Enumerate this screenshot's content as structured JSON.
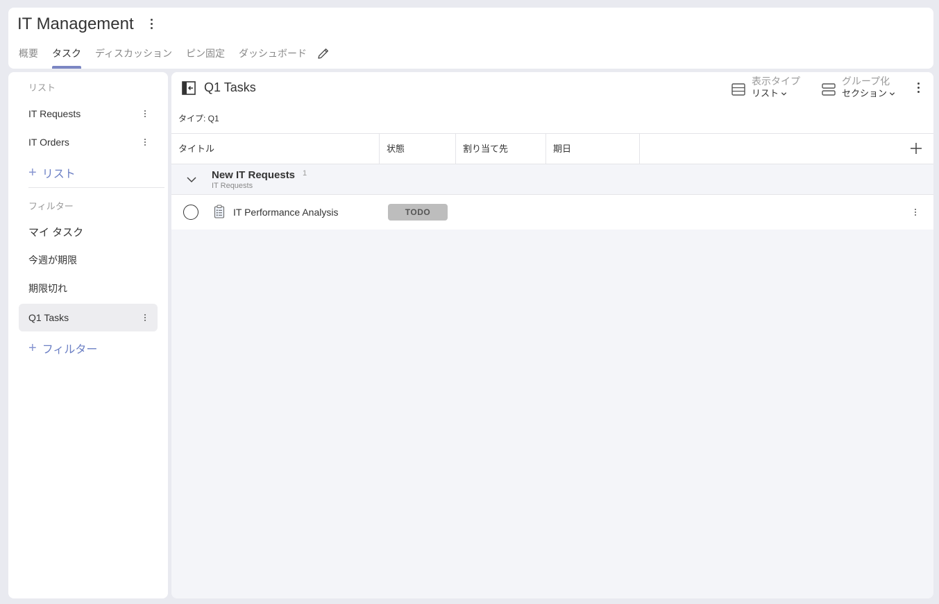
{
  "header": {
    "title": "IT Management",
    "tabs": [
      {
        "label": "概要"
      },
      {
        "label": "タスク"
      },
      {
        "label": "ディスカッション"
      },
      {
        "label": "ピン固定"
      },
      {
        "label": "ダッシュボード"
      }
    ],
    "active_tab": "タスク"
  },
  "sidebar": {
    "lists_heading": "リスト",
    "lists": [
      {
        "label": "IT Requests"
      },
      {
        "label": "IT Orders"
      }
    ],
    "add_list_label": "リスト",
    "filters_heading": "フィルター",
    "filters": [
      {
        "label": "マイ タスク"
      },
      {
        "label": "今週が期限"
      },
      {
        "label": "期限切れ"
      },
      {
        "label": "Q1 Tasks"
      }
    ],
    "active_filter": "Q1 Tasks",
    "add_filter_label": "フィルター"
  },
  "main": {
    "title": "Q1 Tasks",
    "filter_text": "タイプ: Q1",
    "view_type": {
      "label": "表示タイプ",
      "value": "リスト"
    },
    "group_by": {
      "label": "グループ化",
      "value": "セクション"
    },
    "columns": [
      "タイトル",
      "状態",
      "割り当て先",
      "期日"
    ],
    "groups": [
      {
        "name": "New IT Requests",
        "count": "1",
        "source": "IT Requests",
        "tasks": [
          {
            "title": "IT Performance Analysis",
            "status": "TODO",
            "assignee": "",
            "due": ""
          }
        ]
      }
    ]
  },
  "colors": {
    "accent": "#7b86c3",
    "add_link": "#6b7fc4",
    "status_todo_bg": "#bdbdbd",
    "page_bg": "#e9eaf0",
    "content_bg": "#f4f5f9"
  }
}
